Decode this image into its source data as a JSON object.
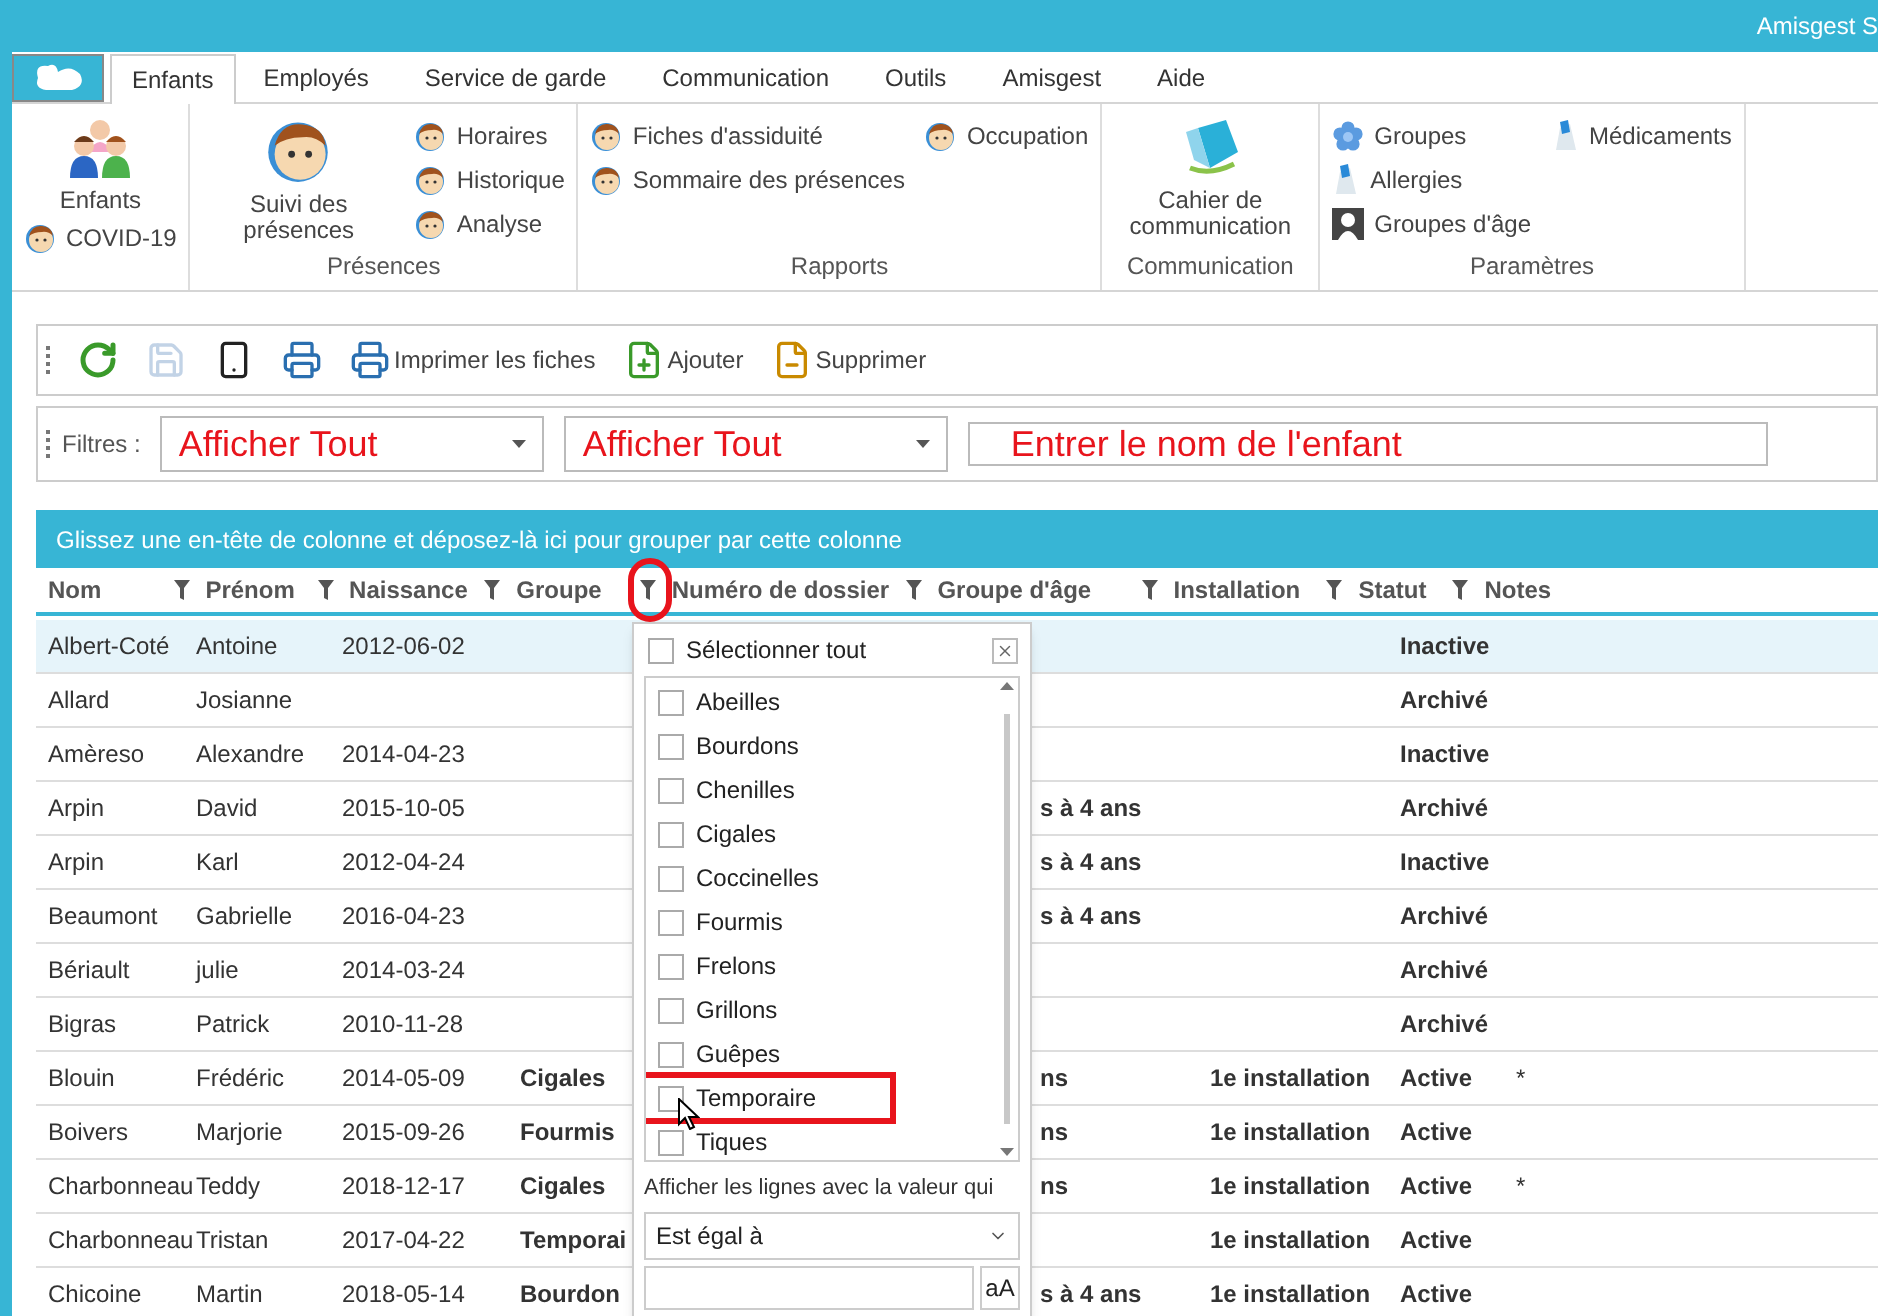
{
  "title_bar": {
    "title": "Amisgest S"
  },
  "ribbon": {
    "tabs": [
      {
        "label": "Enfants",
        "selected": true
      },
      {
        "label": "Employés",
        "selected": false
      },
      {
        "label": "Service de garde",
        "selected": false
      },
      {
        "label": "Communication",
        "selected": false
      },
      {
        "label": "Outils",
        "selected": false
      },
      {
        "label": "Amisgest",
        "selected": false
      },
      {
        "label": "Aide",
        "selected": false
      }
    ],
    "groups": [
      {
        "columns": [
          [
            {
              "label": "Enfants",
              "kind": "large"
            },
            {
              "label": "COVID-19",
              "kind": "small"
            }
          ]
        ]
      },
      {
        "label": "Présences",
        "columns": [
          [
            {
              "label": "Suivi des présences",
              "kind": "large"
            }
          ],
          [
            {
              "label": "Horaires",
              "kind": "small"
            },
            {
              "label": "Historique",
              "kind": "small"
            },
            {
              "label": "Analyse",
              "kind": "small"
            }
          ]
        ]
      },
      {
        "label": "Rapports",
        "columns": [
          [
            {
              "label": "Fiches d'assiduité",
              "kind": "small"
            },
            {
              "label": "Sommaire des présences",
              "kind": "small"
            }
          ],
          [
            {
              "label": "Occupation",
              "kind": "small"
            }
          ]
        ]
      },
      {
        "label": "Communication",
        "columns": [
          [
            {
              "label": "Cahier de communication",
              "kind": "large"
            }
          ]
        ]
      },
      {
        "label": "Paramètres",
        "columns": [
          [
            {
              "label": "Groupes",
              "kind": "small"
            },
            {
              "label": "Allergies",
              "kind": "small"
            },
            {
              "label": "Groupes d'âge",
              "kind": "small"
            }
          ],
          [
            {
              "label": "Médicaments",
              "kind": "small"
            }
          ]
        ]
      }
    ]
  },
  "toolbar": {
    "buttons": [
      {
        "disabled": false
      },
      {
        "disabled": true
      },
      {
        "disabled": false
      },
      {
        "disabled": false
      },
      {
        "label": "Imprimer les fiches",
        "disabled": false
      },
      {
        "label": "Ajouter",
        "disabled": false
      },
      {
        "label": "Supprimer",
        "disabled": false
      }
    ]
  },
  "filters": {
    "label": "Filtres :",
    "dropdowns": [
      {
        "value": "Afficher Tout"
      },
      {
        "value": "Afficher Tout"
      }
    ],
    "search": {
      "placeholder": "Entrer le nom de l'enfant"
    }
  },
  "grid": {
    "group_panel": "Glissez une en-tête de colonne et déposez-là ici pour grouper par cette colonne",
    "columns": [
      {
        "label": "Nom",
        "filter": true,
        "highlighted": false
      },
      {
        "label": "Prénom",
        "filter": true,
        "highlighted": false
      },
      {
        "label": "Naissance",
        "filter": true,
        "highlighted": false
      },
      {
        "label": "Groupe",
        "filter": true,
        "highlighted": true
      },
      {
        "label": "Numéro de dossier",
        "filter": true,
        "highlighted": false
      },
      {
        "label": "Groupe d'âge",
        "filter": true,
        "highlighted": false
      },
      {
        "label": "Installation",
        "filter": true,
        "highlighted": false
      },
      {
        "label": "Statut",
        "filter": true,
        "highlighted": false
      },
      {
        "label": "Notes",
        "filter": false,
        "highlighted": false
      }
    ],
    "rows": [
      {
        "nom": "Albert-Coté",
        "prenom": "Antoine",
        "naissance": "2012-06-02",
        "statut": "Inactive",
        "selected": true
      },
      {
        "nom": "Allard",
        "prenom": "Josianne",
        "statut": "Archivé",
        "selected": false
      },
      {
        "nom": "Amèreso",
        "prenom": "Alexandre",
        "naissance": "2014-04-23",
        "statut": "Inactive",
        "selected": false
      },
      {
        "nom": "Arpin",
        "prenom": "David",
        "naissance": "2015-10-05",
        "groupe_age": "s à 4 ans",
        "statut": "Archivé",
        "selected": false
      },
      {
        "nom": "Arpin",
        "prenom": "Karl",
        "naissance": "2012-04-24",
        "groupe_age": "s à 4 ans",
        "statut": "Inactive",
        "selected": false
      },
      {
        "nom": "Beaumont",
        "prenom": "Gabrielle",
        "naissance": "2016-04-23",
        "groupe_age": "s à 4 ans",
        "statut": "Archivé",
        "selected": false
      },
      {
        "nom": "Bériault",
        "prenom": "julie",
        "naissance": "2014-03-24",
        "statut": "Archivé",
        "selected": false
      },
      {
        "nom": "Bigras",
        "prenom": "Patrick",
        "naissance": "2010-11-28",
        "statut": "Archivé",
        "selected": false
      },
      {
        "nom": "Blouin",
        "prenom": "Frédéric",
        "naissance": "2014-05-09",
        "groupe": "Cigales",
        "groupe_age": "ns",
        "installation": "1e installation",
        "statut": "Active",
        "notes": "*",
        "selected": false
      },
      {
        "nom": "Boivers",
        "prenom": "Marjorie",
        "naissance": "2015-09-26",
        "groupe": "Fourmis",
        "groupe_age": "ns",
        "installation": "1e installation",
        "statut": "Active",
        "selected": false
      },
      {
        "nom": "Charbonneau",
        "prenom": "Teddy",
        "naissance": "2018-12-17",
        "groupe": "Cigales",
        "groupe_age": "ns",
        "installation": "1e installation",
        "statut": "Active",
        "notes": "*",
        "selected": false
      },
      {
        "nom": "Charbonneau",
        "prenom": "Tristan",
        "naissance": "2017-04-22",
        "groupe": "Temporai",
        "installation": "1e installation",
        "statut": "Active",
        "selected": false
      },
      {
        "nom": "Chicoine",
        "prenom": "Martin",
        "naissance": "2018-05-14",
        "groupe": "Bourdon",
        "groupe_age": "s à 4 ans",
        "installation": "1e installation",
        "statut": "Active",
        "selected": false
      }
    ]
  },
  "filter_popup": {
    "select_all": {
      "label": "Sélectionner tout",
      "checked": false
    },
    "items": [
      {
        "label": "Abeilles",
        "checked": false,
        "highlighted": false
      },
      {
        "label": "Bourdons",
        "checked": false,
        "highlighted": false
      },
      {
        "label": "Chenilles",
        "checked": false,
        "highlighted": false
      },
      {
        "label": "Cigales",
        "checked": false,
        "highlighted": false
      },
      {
        "label": "Coccinelles",
        "checked": false,
        "highlighted": false
      },
      {
        "label": "Fourmis",
        "checked": false,
        "highlighted": false
      },
      {
        "label": "Frelons",
        "checked": false,
        "highlighted": false
      },
      {
        "label": "Grillons",
        "checked": false,
        "highlighted": false
      },
      {
        "label": "Guêpes",
        "checked": false,
        "highlighted": false
      },
      {
        "label": "Temporaire",
        "checked": false,
        "highlighted": true
      },
      {
        "label": "Tiques",
        "checked": false,
        "highlighted": false
      }
    ],
    "condition_label": "Afficher les lignes avec la valeur qui",
    "operator": "Est égal à",
    "case_button": "aA"
  }
}
